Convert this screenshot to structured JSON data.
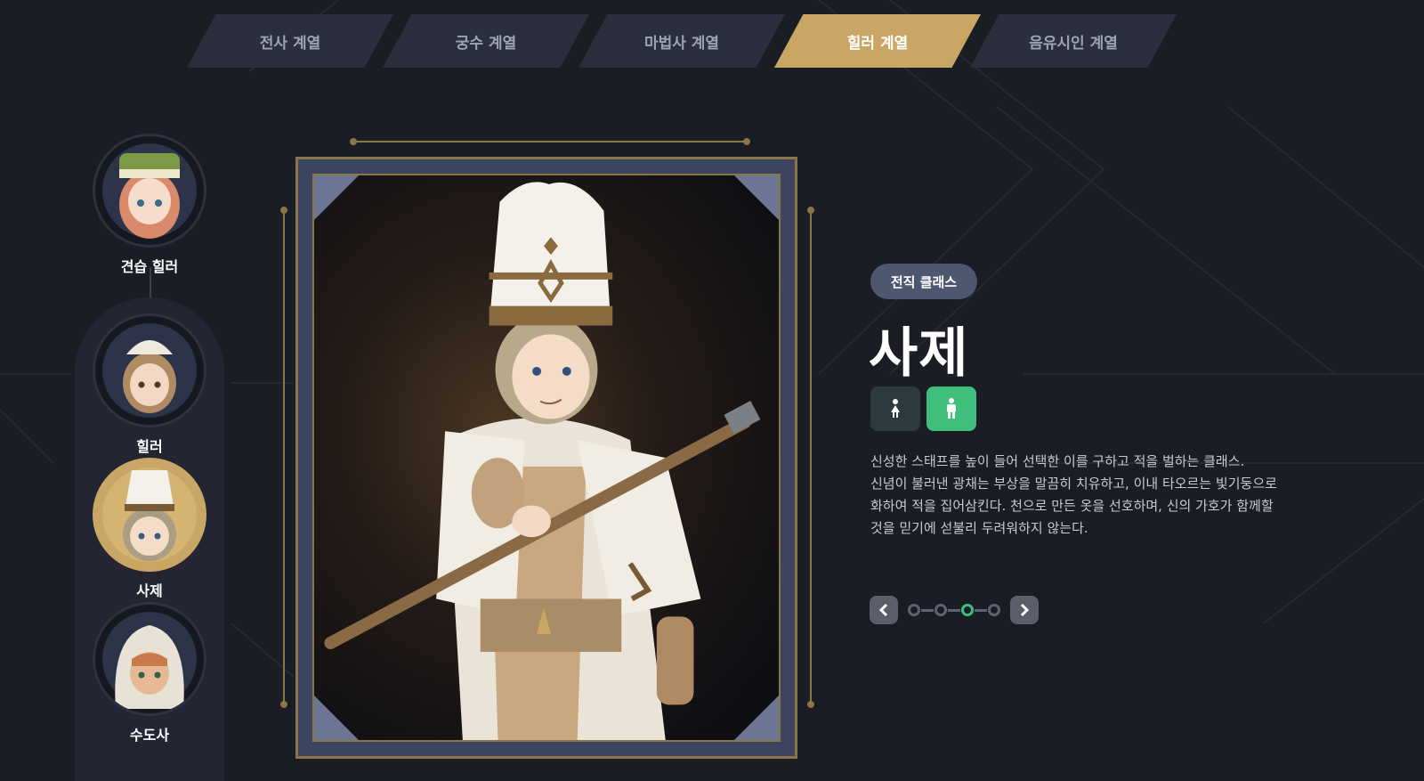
{
  "tabs": [
    {
      "label": "전사 계열",
      "active": false
    },
    {
      "label": "궁수 계열",
      "active": false
    },
    {
      "label": "마법사 계열",
      "active": false
    },
    {
      "label": "힐러 계열",
      "active": true
    },
    {
      "label": "음유시인 계열",
      "active": false
    }
  ],
  "class_tree": [
    {
      "label": "견습 힐러",
      "active": false
    },
    {
      "label": "힐러",
      "active": false
    },
    {
      "label": "사제",
      "active": true
    },
    {
      "label": "수도사",
      "active": false
    }
  ],
  "detail": {
    "badge": "전직 클래스",
    "class_name": "사제",
    "gender_selected": "male",
    "description": [
      "신성한 스태프를 높이 들어 선택한 이를 구하고 적을 벌하는 클래스.",
      "신념이 불러낸 광채는 부상을 말끔히 치유하고, 이내 타오르는 빛기둥으로",
      "화하여 적을 집어삼킨다. 천으로 만든 옷을 선호하며, 신의 가호가 함께할",
      "것을 믿기에 섣불리 두려워하지 않는다."
    ]
  },
  "pager": {
    "total": 4,
    "current_index": 2
  },
  "colors": {
    "background": "#1b1d24",
    "accent_gold": "#c9a664",
    "accent_green": "#3fbe7c",
    "tab_inactive": "#2b2e3c"
  },
  "icons": [
    "female-icon",
    "male-icon",
    "chevron-left-icon",
    "chevron-right-icon"
  ]
}
